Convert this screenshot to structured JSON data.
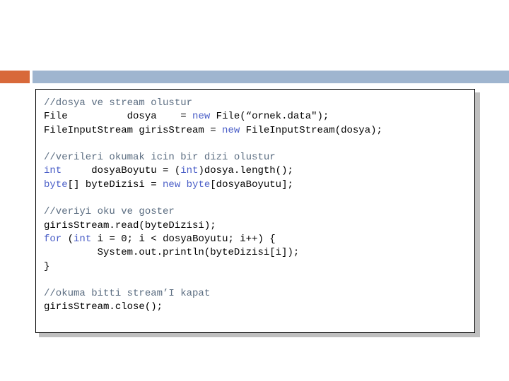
{
  "colors": {
    "accent": "#d8693a",
    "title_bar": "#9fb5cf",
    "comment": "#5a6c80",
    "keyword": "#4a5ec7",
    "text": "#000000",
    "shadow": "#bfbfbf"
  },
  "code_lines": [
    [
      {
        "t": "//dosya ve stream olustur",
        "c": "comment"
      }
    ],
    [
      {
        "t": "File          dosya    = ",
        "c": "text"
      },
      {
        "t": "new",
        "c": "keyword"
      },
      {
        "t": " File(“ornek.data\");",
        "c": "text"
      }
    ],
    [
      {
        "t": "FileInputStream girisStream = ",
        "c": "text"
      },
      {
        "t": "new",
        "c": "keyword"
      },
      {
        "t": " FileInputStream(dosya);",
        "c": "text"
      }
    ],
    [],
    [
      {
        "t": "//verileri okumak icin bir dizi olustur",
        "c": "comment"
      }
    ],
    [
      {
        "t": "int",
        "c": "keyword"
      },
      {
        "t": "     dosyaBoyutu = (",
        "c": "text"
      },
      {
        "t": "int",
        "c": "keyword"
      },
      {
        "t": ")dosya.length();",
        "c": "text"
      }
    ],
    [
      {
        "t": "byte",
        "c": "keyword"
      },
      {
        "t": "[] byteDizisi = ",
        "c": "text"
      },
      {
        "t": "new",
        "c": "keyword"
      },
      {
        "t": " ",
        "c": "text"
      },
      {
        "t": "byte",
        "c": "keyword"
      },
      {
        "t": "[dosyaBoyutu];",
        "c": "text"
      }
    ],
    [],
    [
      {
        "t": "//veriyi oku ve goster",
        "c": "comment"
      }
    ],
    [
      {
        "t": "girisStream.read(byteDizisi);",
        "c": "text"
      }
    ],
    [
      {
        "t": "for",
        "c": "keyword"
      },
      {
        "t": " (",
        "c": "text"
      },
      {
        "t": "int",
        "c": "keyword"
      },
      {
        "t": " i = 0; i < dosyaBoyutu; i++) {",
        "c": "text"
      }
    ],
    [
      {
        "t": "         System.out.println(byteDizisi[i]);",
        "c": "text"
      }
    ],
    [
      {
        "t": "}",
        "c": "text"
      }
    ],
    [],
    [
      {
        "t": "//okuma bitti stream’I kapat",
        "c": "comment"
      }
    ],
    [
      {
        "t": "girisStream.close();",
        "c": "text"
      }
    ]
  ]
}
